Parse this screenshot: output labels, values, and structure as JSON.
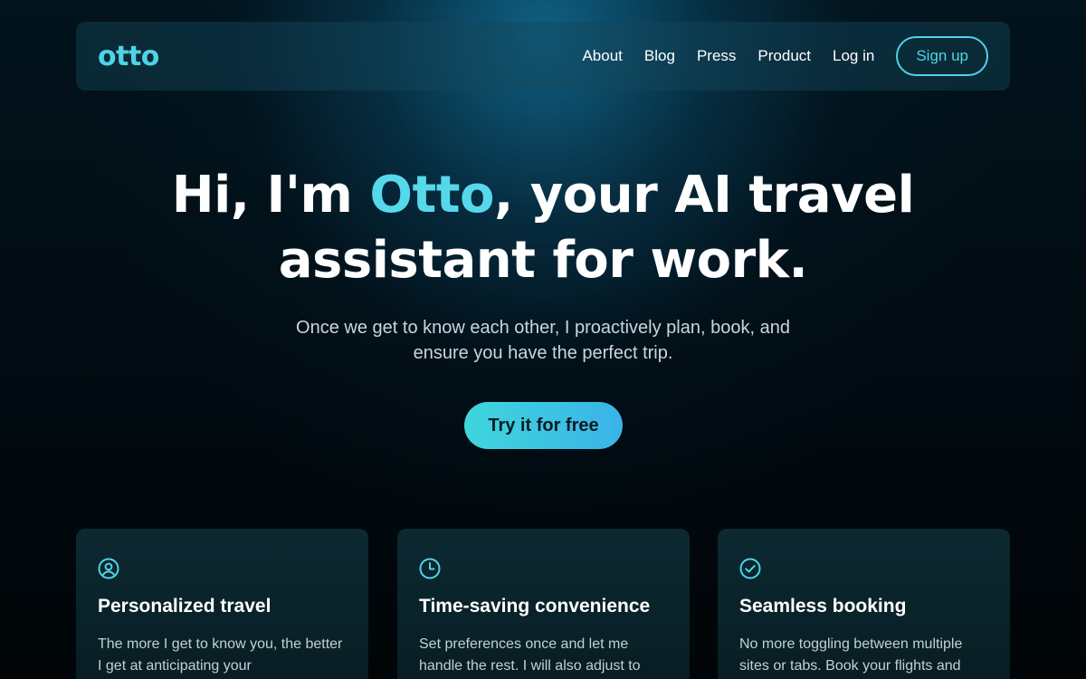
{
  "brand": {
    "logo_text": "otto",
    "accent_color": "#4fd3e6"
  },
  "nav": {
    "links": [
      "About",
      "Blog",
      "Press",
      "Product",
      "Log in"
    ],
    "signup_label": "Sign up"
  },
  "hero": {
    "title_before": "Hi, I'm ",
    "title_accent": "Otto",
    "title_line1_after": ", your AI travel",
    "title_line2": "assistant for work.",
    "subtitle": "Once we get to know each other, I proactively plan, book, and ensure you have the perfect trip.",
    "cta_label": "Try it for free"
  },
  "features": [
    {
      "icon": "user-circle-icon",
      "title": "Personalized travel",
      "body": "The more I get to know you, the better I get at anticipating your"
    },
    {
      "icon": "clock-icon",
      "title": "Time-saving convenience",
      "body": "Set preferences once and let me handle the rest. I will also adjust to"
    },
    {
      "icon": "check-circle-icon",
      "title": "Seamless booking",
      "body": "No more toggling between multiple sites or tabs. Book your flights and"
    }
  ]
}
